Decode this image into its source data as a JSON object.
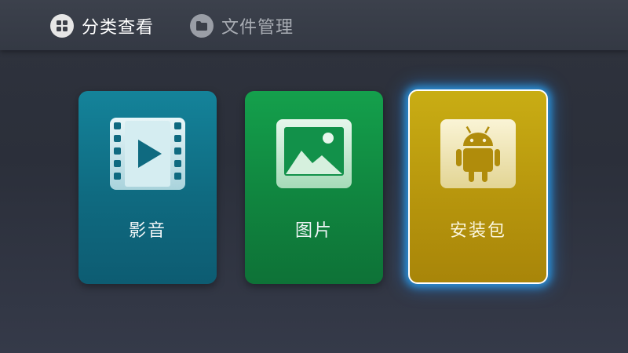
{
  "tabs": {
    "category": {
      "label": "分类查看",
      "icon": "grid-icon",
      "active": true
    },
    "files": {
      "label": "文件管理",
      "icon": "folder-icon",
      "active": false
    }
  },
  "cards": {
    "video": {
      "label": "影音",
      "icon": "film-play-icon",
      "color": "#11758c"
    },
    "photo": {
      "label": "图片",
      "icon": "picture-icon",
      "color": "#119447"
    },
    "apk": {
      "label": "安装包",
      "icon": "android-icon",
      "color": "#bb9a0e",
      "focused": true
    }
  },
  "colors": {
    "background": "#2f333d",
    "focus_glow": "#28aaff"
  }
}
